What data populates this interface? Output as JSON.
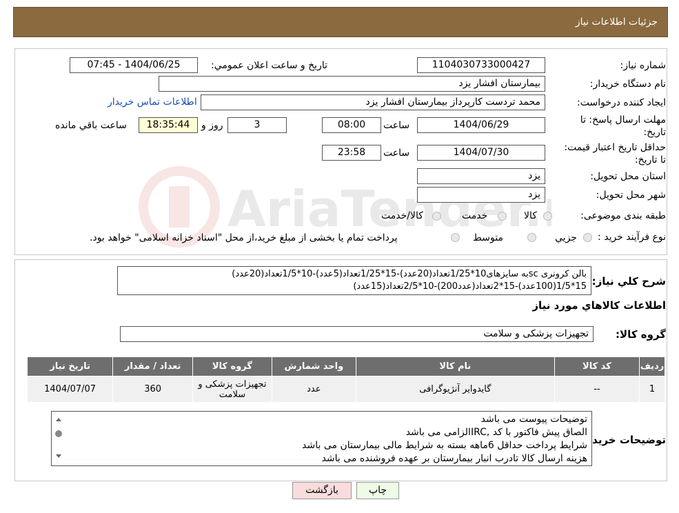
{
  "header": {
    "title": "جزئیات اطلاعات نیاز"
  },
  "fields": {
    "need_number_label": "شماره نیاز:",
    "need_number": "1104030733000427",
    "announce_label": "تاریخ و ساعت اعلان عمومي:",
    "announce_value": "1404/06/25 - 07:45",
    "buyer_org_label": "نام دستگاه خريدار:",
    "buyer_org": "بیمارستان افشار یزد",
    "creator_label": "ايجاد کننده درخواست:",
    "creator": "محمد تردست کارپرداز بیمارستان افشار یزد",
    "contact_link": "اطلاعات تماس خريدار",
    "deadline_label": "مهلت ارسال پاسخ: تا تاریخ:",
    "deadline_date": "1404/06/29",
    "time_label": "ساعت",
    "deadline_time": "08:00",
    "days_value": "3",
    "days_label": "روز و",
    "remaining_time": "18:35:44",
    "remaining_label": "ساعت باقي مانده",
    "validity_label": "حداقل تاريخ اعتبار قيمت: تا تاریخ:",
    "validity_date": "1404/07/30",
    "validity_time": "23:58",
    "province_label": "استان محل تحويل:",
    "province": "یزد",
    "city_label": "شهر محل تحويل:",
    "city": "یزد",
    "category_label": "طبقه بندی موضوعی:",
    "category_options": [
      "کالا",
      "خدمت",
      "کالا/خدمت"
    ],
    "purchase_type_label": "نوع فرآيند خريد :",
    "purchase_options": [
      "جزيي",
      "متوسط"
    ],
    "purchase_note": "پرداخت تمام یا بخشی از مبلغ خرید،از محل \"اسناد خزانه اسلامی\" خواهد بود."
  },
  "summary": {
    "label": "شرح کلي نياز:",
    "line1": "بالن کرونری scبه سایزهای10*1/25تعداد(20عدد)-15*1/25تعداد(5عدد)-10*1/5تعداد(20عدد)",
    "line2": "15*1/5(100عدد)-15*2تعداد(عدد200)-10*2/5تعداد(15عدد)"
  },
  "items_section": {
    "title": "اطلاعات کالاهاي مورد نياز",
    "group_label": "گروه کالا:",
    "group_value": "تجهیزات پزشکی و سلامت",
    "columns": [
      "رديف",
      "کد کالا",
      "نام کالا",
      "واحد شمارش",
      "گروه کالا",
      "تعداد / مقدار",
      "تاريخ نياز"
    ],
    "rows": [
      [
        "1",
        "--",
        "گایدوایر آنژیوگرافی",
        "عدد",
        "تجهیزات پزشکی و سلامت",
        "360",
        "1404/07/07"
      ]
    ]
  },
  "buyer_notes": {
    "label": "توضيحات خريدار:",
    "lines": [
      "توضیحات پیوست می باشد",
      "الصاق پیش فاکتور با کد  ,IRCالزامی می باشد",
      "شرایط پرداخت حداقل 6ماهه بسته به شرایط مالی بیمارستان می باشد",
      "هزینه ارسال کالا تادرب انبار بیمارستان بر عهده فروشنده می باشد"
    ]
  },
  "buttons": {
    "print": "چاپ",
    "back": "بازگشت"
  },
  "watermark": {
    "text": "AriaTender.neT"
  },
  "colors": {
    "header_bg": "#8a6a3e",
    "table_header_bg": "#6e6e6e",
    "back_button_bg": "#f9dcdc",
    "print_button_bg": "#eefbe6"
  }
}
